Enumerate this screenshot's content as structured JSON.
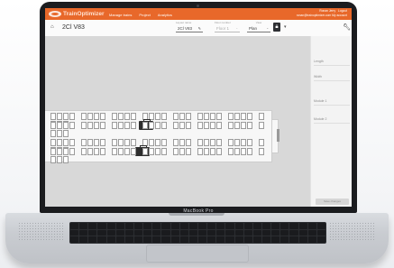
{
  "header": {
    "brand": "TrainOptimizer",
    "nav": [
      "Manage trains",
      "Project",
      "Analytics"
    ],
    "user_name": "Ronan Jerry",
    "logout": "Logout",
    "user_meta": "ronan@trainoptimizer.com  My account",
    "accent_color": "#e8682a"
  },
  "toolbar": {
    "car_name": "2Cl V83",
    "car_number_label": "Layout name",
    "car_number_value": "2Cl V83",
    "floor_label": "Floor number",
    "floor_value": "Floor 1",
    "view_label": "View",
    "view_value": "Plan",
    "home_icon": "home-icon",
    "edit_icon": "pencil-icon",
    "lock_icon": "lock-icon",
    "settings_icon": "wrench-icon"
  },
  "panel": {
    "fields": [
      "Length",
      "Width",
      "Module 1",
      "Module 2"
    ],
    "save_label": "Save changes"
  },
  "device": {
    "model": "MacBook Pro"
  },
  "colors": {
    "canvas": "#d8d8d8",
    "seat_border": "#9b9b9b",
    "luggage": "#2d2d2d"
  }
}
